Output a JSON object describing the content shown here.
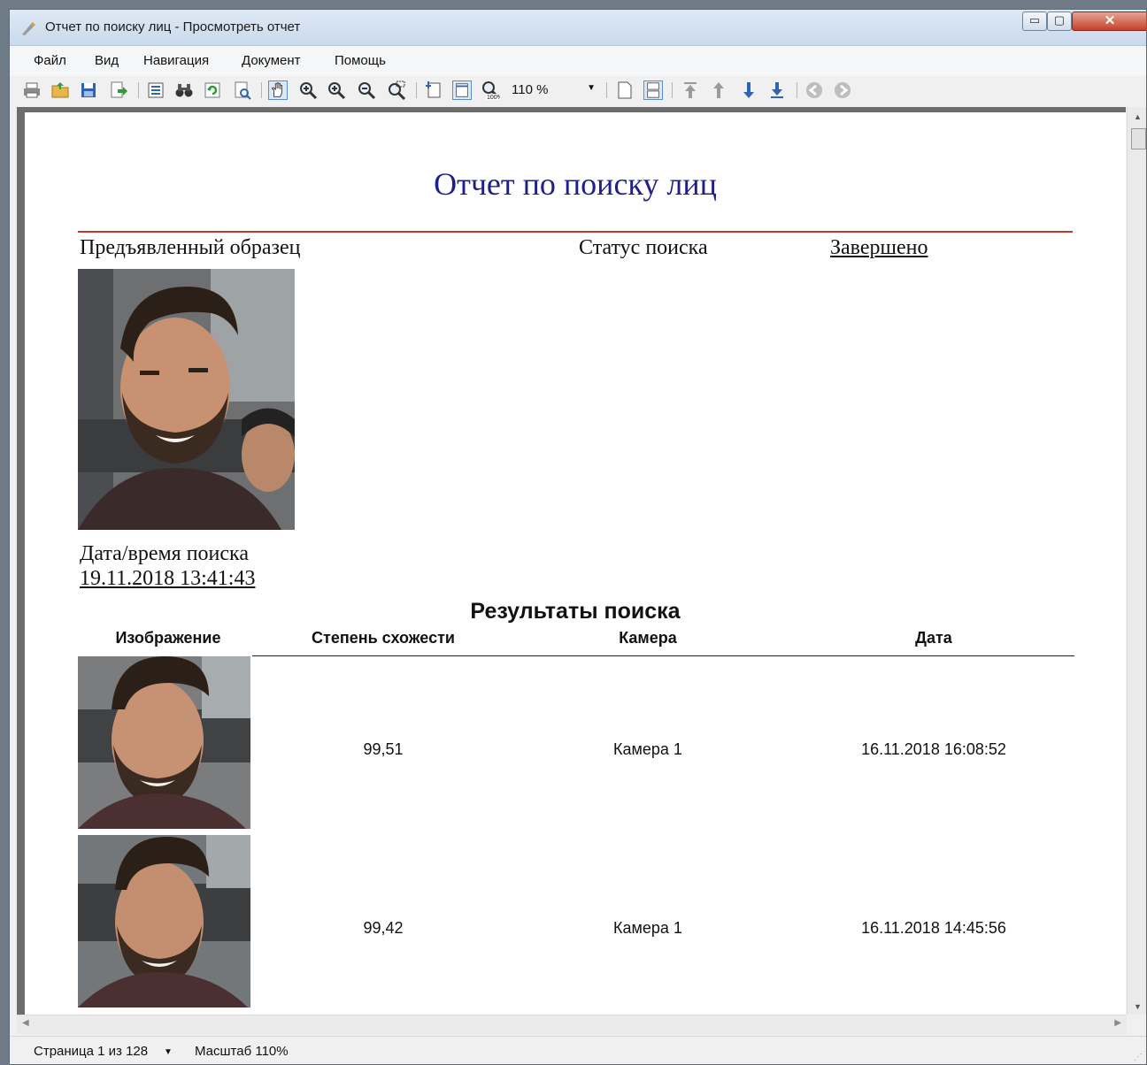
{
  "window": {
    "title": "Отчет по поиску лиц - Просмотреть отчет",
    "min_glyph": "▭",
    "max_glyph": "▢",
    "close_glyph": "✕"
  },
  "menu": {
    "items": [
      "Файл",
      "Вид",
      "Навигация",
      "Документ",
      "Помощь"
    ]
  },
  "toolbar": {
    "zoom_value": "110 %",
    "zoom_arrow": "▼"
  },
  "report": {
    "title": "Отчет по поиску лиц",
    "sample_label": "Предъявленный образец",
    "status_label": "Статус поиска",
    "status_value": "Завершено",
    "datetime_label": "Дата/время поиска",
    "datetime_value": "19.11.2018 13:41:43",
    "results_title": "Результаты поиска",
    "columns": [
      "Изображение",
      "Степень схожести",
      "Камера",
      "Дата"
    ],
    "rows": [
      {
        "similarity": "99,51",
        "camera": "Камера 1",
        "date": "16.11.2018 16:08:52"
      },
      {
        "similarity": "99,42",
        "camera": "Камера 1",
        "date": "16.11.2018 14:45:56"
      }
    ]
  },
  "statusbar": {
    "page": "Страница 1 из 128",
    "page_arrow": "▼",
    "zoom": "Масштаб 110%"
  },
  "scroll": {
    "up": "▲",
    "down": "▼",
    "left": "◀",
    "right": "▶",
    "grip": "⋰"
  },
  "colors": {
    "title_blue": "#1f1f8c",
    "rule_red": "#c0392b"
  }
}
